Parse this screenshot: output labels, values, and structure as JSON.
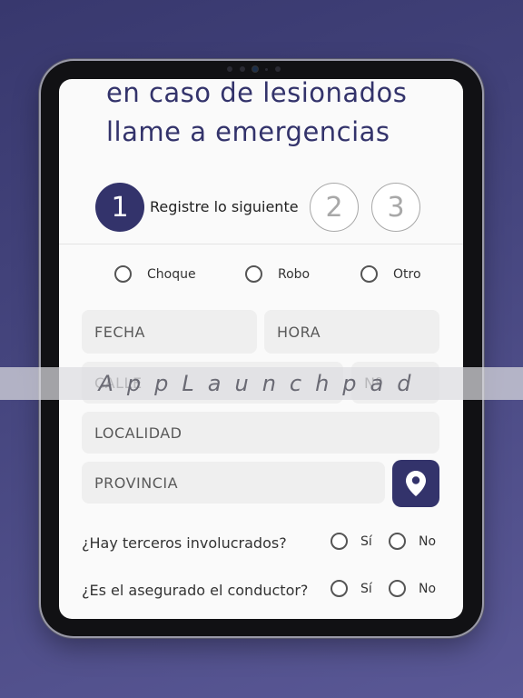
{
  "header": {
    "line1": "en caso de lesionados",
    "line2": "llame a emergencias"
  },
  "steps": {
    "active_number": "1",
    "active_label": "Registre lo siguiente",
    "step2": "2",
    "step3": "3"
  },
  "incident_types": [
    {
      "label": "Choque"
    },
    {
      "label": "Robo"
    },
    {
      "label": "Otro"
    }
  ],
  "fields": {
    "fecha": "FECHA",
    "hora": "HORA",
    "calle": "CALLE",
    "numero": "Nº",
    "localidad": "LOCALIDAD",
    "provincia": "PROVINCIA"
  },
  "questions": [
    {
      "text": "¿Hay terceros involucrados?",
      "yes": "Sí",
      "no": "No"
    },
    {
      "text": "¿Es el asegurado el conductor?",
      "yes": "Sí",
      "no": "No"
    }
  ],
  "icons": {
    "location": "location-pin-icon"
  },
  "colors": {
    "accent": "#33336b",
    "field_bg": "#efefef",
    "background": "#44447c"
  },
  "watermark": "AppLaunchpad"
}
